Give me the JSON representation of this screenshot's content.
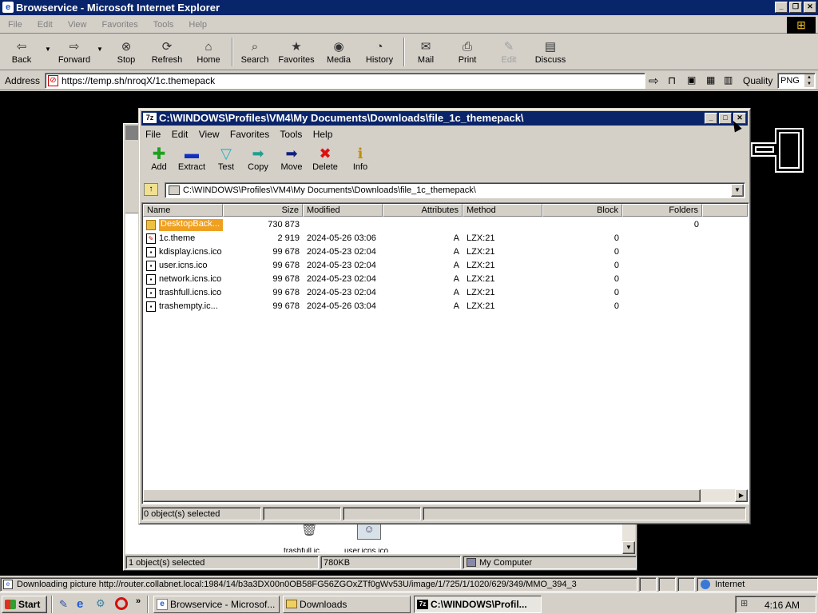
{
  "ie": {
    "title": "Browservice - Microsoft Internet Explorer",
    "menu": [
      "File",
      "Edit",
      "View",
      "Favorites",
      "Tools",
      "Help"
    ],
    "toolbar": [
      {
        "label": "Back",
        "icon": "back-arrow-icon"
      },
      {
        "label": "Forward",
        "icon": "forward-arrow-icon"
      },
      {
        "label": "Stop",
        "icon": "stop-icon"
      },
      {
        "label": "Refresh",
        "icon": "refresh-icon"
      },
      {
        "label": "Home",
        "icon": "home-icon"
      },
      {
        "label": "Search",
        "icon": "search-icon"
      },
      {
        "label": "Favorites",
        "icon": "favorites-icon"
      },
      {
        "label": "Media",
        "icon": "media-icon"
      },
      {
        "label": "History",
        "icon": "history-icon"
      },
      {
        "label": "Mail",
        "icon": "mail-icon"
      },
      {
        "label": "Print",
        "icon": "print-icon"
      },
      {
        "label": "Edit",
        "icon": "edit-icon"
      },
      {
        "label": "Discuss",
        "icon": "discuss-icon"
      }
    ],
    "address_label": "Address",
    "address": "https://temp.sh/nroqX/1c.themepack",
    "quality_label": "Quality",
    "quality_value": "PNG",
    "status": "Downloading picture http://router.collabnet.local:1984/14/b3a3DX00n0OB58FG56ZGOxZTf0gWv53U/image/1/725/1/1020/629/349/MMO_394_3",
    "zone": "Internet"
  },
  "explorer": {
    "status": "1 object(s) selected",
    "size": "780KB",
    "zone": "My Computer",
    "icons": [
      "trashfull.ic...",
      "user.icns.ico"
    ]
  },
  "zip": {
    "title": "C:\\WINDOWS\\Profiles\\VM4\\My Documents\\Downloads\\file_1c_themepack\\",
    "menu": [
      "File",
      "Edit",
      "View",
      "Favorites",
      "Tools",
      "Help"
    ],
    "toolbar": [
      {
        "label": "Add",
        "icon": "add-icon",
        "color": "#1ea01e",
        "glyph": "✚"
      },
      {
        "label": "Extract",
        "icon": "extract-icon",
        "color": "#1030c0",
        "glyph": "▬"
      },
      {
        "label": "Test",
        "icon": "test-icon",
        "color": "#20b0c0",
        "glyph": "▽"
      },
      {
        "label": "Copy",
        "icon": "copy-icon",
        "color": "#20a090",
        "glyph": "➡"
      },
      {
        "label": "Move",
        "icon": "move-icon",
        "color": "#102080",
        "glyph": "➡"
      },
      {
        "label": "Delete",
        "icon": "delete-icon",
        "color": "#e01010",
        "glyph": "✖"
      },
      {
        "label": "Info",
        "icon": "info-icon",
        "color": "#c09000",
        "glyph": "ℹ"
      }
    ],
    "path": "C:\\WINDOWS\\Profiles\\VM4\\My Documents\\Downloads\\file_1c_themepack\\",
    "columns": [
      "Name",
      "Size",
      "Modified",
      "Attributes",
      "Method",
      "Block",
      "Folders"
    ],
    "rows": [
      {
        "name": "DesktopBack...",
        "size": "730 873",
        "modified": "",
        "attr": "",
        "method": "",
        "block": "",
        "folders": "0",
        "type": "folder"
      },
      {
        "name": "1c.theme",
        "size": "2 919",
        "modified": "2024-05-26 03:06",
        "attr": "A",
        "method": "LZX:21",
        "block": "0",
        "folders": "",
        "type": "theme"
      },
      {
        "name": "kdisplay.icns.ico",
        "size": "99 678",
        "modified": "2024-05-23 02:04",
        "attr": "A",
        "method": "LZX:21",
        "block": "0",
        "folders": "",
        "type": "file"
      },
      {
        "name": "user.icns.ico",
        "size": "99 678",
        "modified": "2024-05-23 02:04",
        "attr": "A",
        "method": "LZX:21",
        "block": "0",
        "folders": "",
        "type": "file"
      },
      {
        "name": "network.icns.ico",
        "size": "99 678",
        "modified": "2024-05-23 02:04",
        "attr": "A",
        "method": "LZX:21",
        "block": "0",
        "folders": "",
        "type": "file"
      },
      {
        "name": "trashfull.icns.ico",
        "size": "99 678",
        "modified": "2024-05-23 02:04",
        "attr": "A",
        "method": "LZX:21",
        "block": "0",
        "folders": "",
        "type": "file"
      },
      {
        "name": "trashempty.ic...",
        "size": "99 678",
        "modified": "2024-05-26 03:04",
        "attr": "A",
        "method": "LZX:21",
        "block": "0",
        "folders": "",
        "type": "file"
      }
    ],
    "status": "0 object(s) selected"
  },
  "taskbar": {
    "start": "Start",
    "tasks": [
      "Browservice - Microsof...",
      "Downloads",
      "C:\\WINDOWS\\Profil..."
    ],
    "time": "4:16 AM"
  },
  "colors": {
    "ie_title": "#0a2a6a",
    "zip_title": "#0a246a",
    "selection": "#f0a020",
    "desktop": "#000000"
  }
}
